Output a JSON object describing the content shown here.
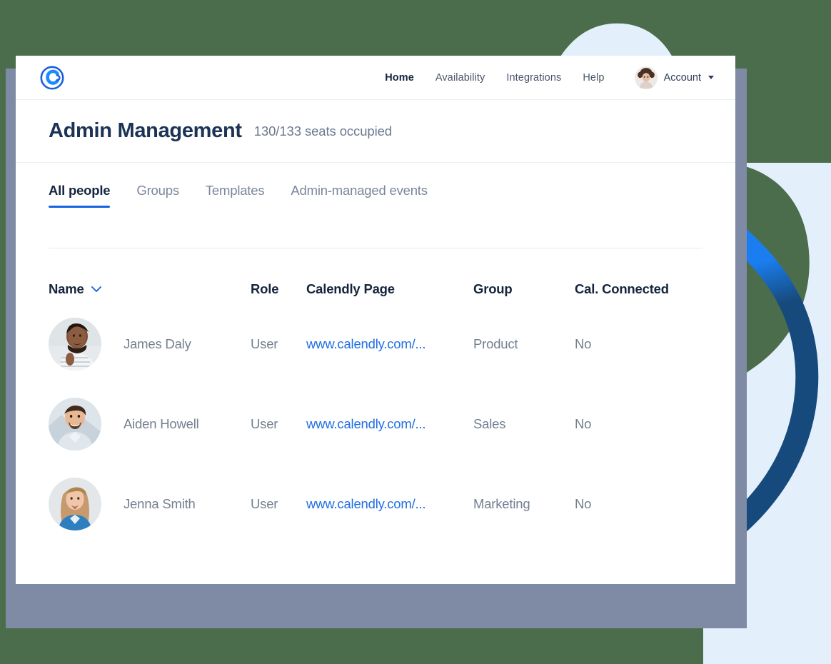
{
  "theme": {
    "background_green": "#4c6d4c",
    "shadow_panel": "#7f8aa4",
    "card_white": "#ffffff",
    "accent_blue": "#1464e0",
    "link_blue": "#1f6fe5",
    "navy_dark": "#1b3354",
    "navy_deep": "#174a7c",
    "blob_light_blue": "#e3f0fb",
    "text_gray": "#737f91"
  },
  "topnav": {
    "logo_name": "calendly-logo",
    "links": [
      {
        "label": "Home",
        "active": true
      },
      {
        "label": "Availability",
        "active": false
      },
      {
        "label": "Integrations",
        "active": false
      },
      {
        "label": "Help",
        "active": false
      }
    ],
    "account": {
      "label": "Account",
      "avatar_alt": "account-avatar",
      "caret": "chevron-down-icon"
    }
  },
  "page": {
    "title": "Admin Management",
    "seats": "130/133 seats occupied"
  },
  "tabs": [
    {
      "label": "All people",
      "active": true
    },
    {
      "label": "Groups",
      "active": false
    },
    {
      "label": "Templates",
      "active": false
    },
    {
      "label": "Admin-managed events",
      "active": false
    }
  ],
  "table": {
    "columns": [
      {
        "label": "Name",
        "sortable": true,
        "sort_icon": "chevron-down-icon"
      },
      {
        "label": "Role",
        "sortable": false
      },
      {
        "label": "Calendly Page",
        "sortable": false
      },
      {
        "label": "Group",
        "sortable": false
      },
      {
        "label": "Cal. Connected",
        "sortable": false
      }
    ],
    "rows": [
      {
        "name": "James Daly",
        "role": "User",
        "calendly_page": "www.calendly.com/...",
        "group": "Product",
        "cal_connected": "No",
        "avatar_alt": "avatar-james-daly"
      },
      {
        "name": "Aiden Howell",
        "role": "User",
        "calendly_page": "www.calendly.com/...",
        "group": "Sales",
        "cal_connected": "No",
        "avatar_alt": "avatar-aiden-howell"
      },
      {
        "name": "Jenna Smith",
        "role": "User",
        "calendly_page": "www.calendly.com/...",
        "group": "Marketing",
        "cal_connected": "No",
        "avatar_alt": "avatar-jenna-smith"
      }
    ]
  }
}
